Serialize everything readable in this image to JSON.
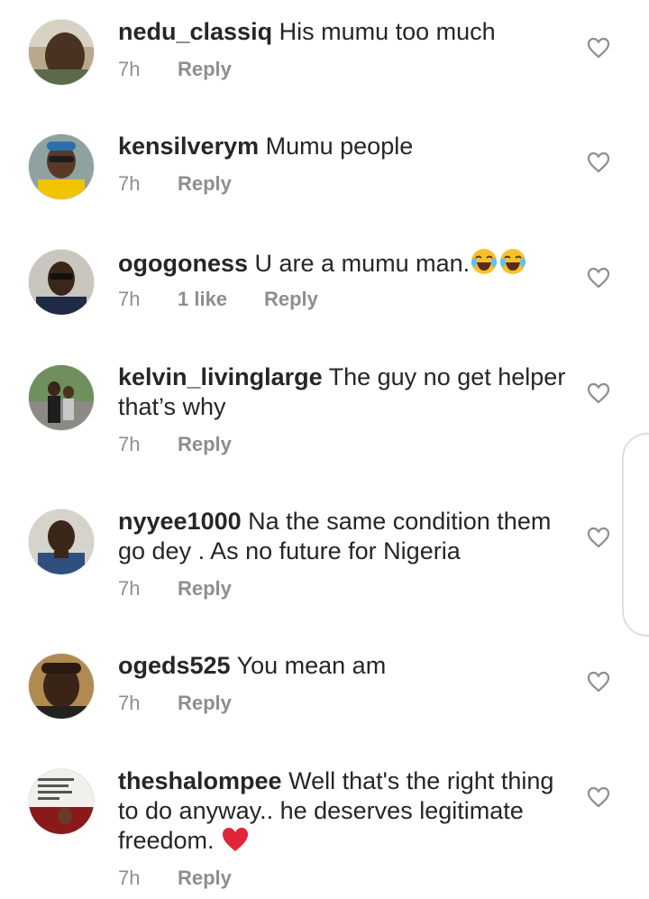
{
  "comments": [
    {
      "username": "nedu_classiq",
      "text": "His mumu too much",
      "time": "7h",
      "likes": "",
      "reply": "Reply",
      "avatar": "photo-dark-skinned-man-selfie"
    },
    {
      "username": "kensilverym",
      "text": "Mumu people",
      "time": "7h",
      "likes": "",
      "reply": "Reply",
      "avatar": "photo-man-sunglasses-yellow-jersey"
    },
    {
      "username": "ogogoness",
      "text": "U are a mumu man.",
      "time": "7h",
      "likes": "1 like",
      "reply": "Reply",
      "emoji": [
        "laughing-emoji",
        "laughing-emoji"
      ],
      "avatar": "photo-man-sunglasses"
    },
    {
      "username": "kelvin_livinglarge",
      "text": "The guy no get helper that’s why",
      "time": "7h",
      "likes": "",
      "reply": "Reply",
      "avatar": "photo-people-outdoors"
    },
    {
      "username": "nyyee1000",
      "text": "Na the same condition them go dey . As no future for Nigeria",
      "time": "7h",
      "likes": "",
      "reply": "Reply",
      "avatar": "photo-man-blue-tank-top"
    },
    {
      "username": "ogeds525",
      "text": "You mean am",
      "time": "7h",
      "likes": "",
      "reply": "Reply",
      "avatar": "photo-man-selfie-hand-on-head"
    },
    {
      "username": "theshalompee",
      "text": "Well that's the right thing to do anyway.. he deserves legitimate freedom.",
      "time": "7h",
      "likes": "",
      "reply": "Reply",
      "emoji": [
        "red-heart-emoji"
      ],
      "avatar": "photo-flyer-with-text-and-woman"
    }
  ],
  "colors": {
    "text": "#262626",
    "meta": "#8e8e8e",
    "heart_outline": "#8e8e8e",
    "emoji_face": "#f7c12b",
    "red_heart": "#e0243a"
  }
}
